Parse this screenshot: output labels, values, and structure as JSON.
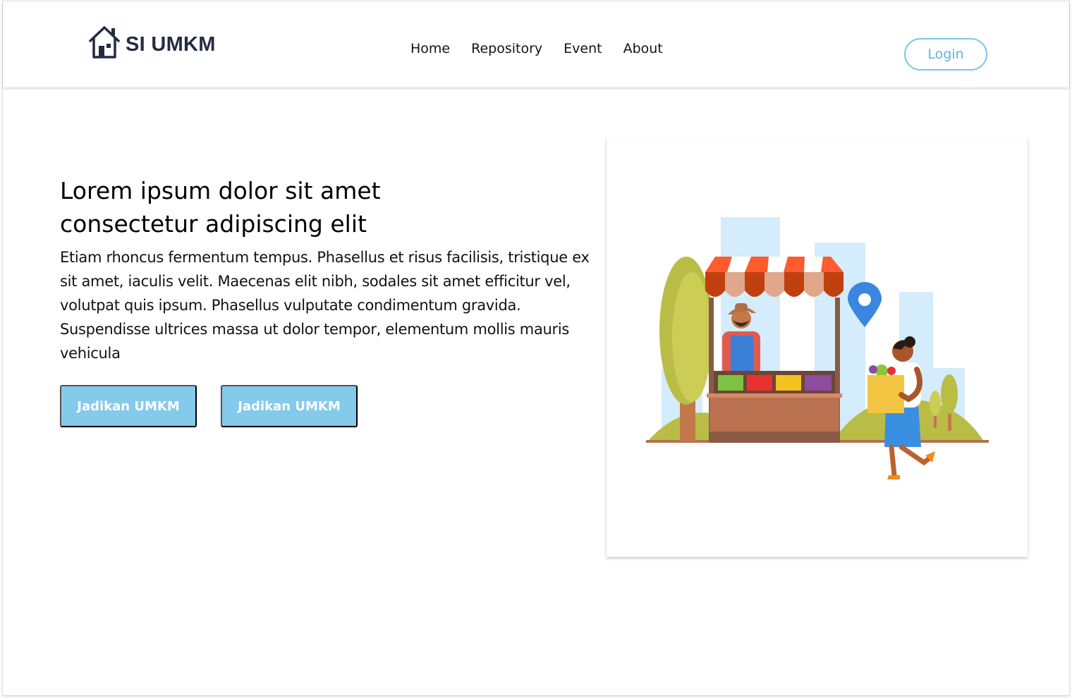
{
  "brand": {
    "name": "SI UMKM",
    "icon": "house-icon"
  },
  "nav": {
    "links": [
      {
        "label": "Home"
      },
      {
        "label": "Repository"
      },
      {
        "label": "Event"
      },
      {
        "label": "About"
      }
    ],
    "login_label": "Login"
  },
  "hero": {
    "title_line1": "Lorem ipsum dolor sit amet",
    "title_line2": "consectetur adipiscing elit",
    "description": "Etiam rhoncus fermentum tempus. Phasellus et risus facilisis, tristique ex sit amet, iaculis velit. Maecenas elit nibh, sodales sit amet efficitur vel, volutpat quis ipsum. Phasellus vulputate condimentum gravida. Suspendisse ultrices massa ut dolor tempor, elementum mollis mauris vehicula",
    "buttons": [
      {
        "label": "Jadikan UMKM"
      },
      {
        "label": "Jadikan UMKM"
      }
    ]
  },
  "illustration": {
    "icon": "market-stall-illustration"
  },
  "colors": {
    "accent": "#84caea",
    "login_border": "#7cc7e8",
    "brand_text": "#232c42"
  }
}
